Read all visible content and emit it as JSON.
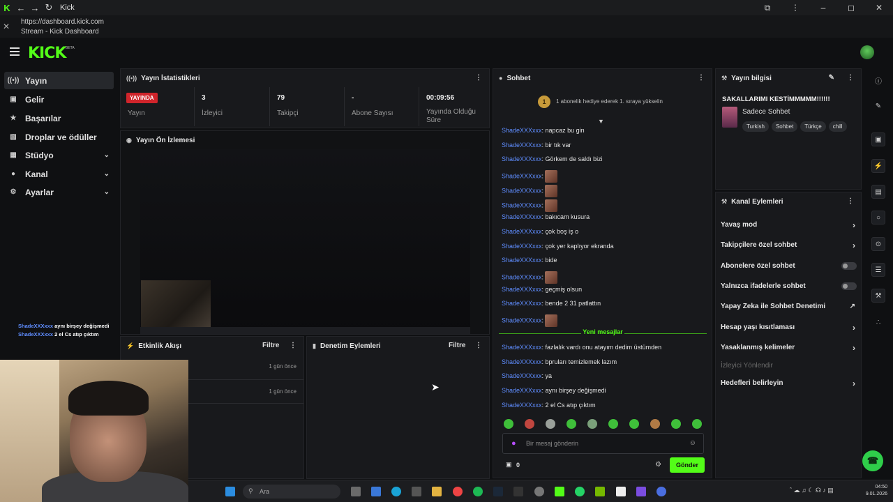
{
  "window": {
    "title": "Kick",
    "url": "https://dashboard.kick.com",
    "page_title": "Stream - Kick Dashboard"
  },
  "brand": {
    "logo": "KICK",
    "logo_badge": "BETA",
    "accent": "#53fc18"
  },
  "sidebar": {
    "items": [
      {
        "label": "Yayın",
        "icon": "broadcast-icon"
      },
      {
        "label": "Gelir",
        "icon": "wallet-icon"
      },
      {
        "label": "Başarılar",
        "icon": "trophy-icon"
      },
      {
        "label": "Droplar ve ödüller",
        "icon": "gift-icon"
      },
      {
        "label": "Stüdyo",
        "icon": "layout-icon",
        "expandable": true
      },
      {
        "label": "Kanal",
        "icon": "user-icon",
        "expandable": true
      },
      {
        "label": "Ayarlar",
        "icon": "gear-icon",
        "expandable": true
      }
    ]
  },
  "stats": {
    "title": "Yayın İstatistikleri",
    "live_badge": "YAYINDA",
    "items": [
      {
        "value": "",
        "label": "Yayın"
      },
      {
        "value": "3",
        "label": "İzleyici"
      },
      {
        "value": "79",
        "label": "Takipçi"
      },
      {
        "value": "-",
        "label": "Abone Sayısı"
      },
      {
        "value": "00:09:56",
        "label": "Yayında Olduğu Süre"
      }
    ]
  },
  "preview": {
    "title": "Yayın Ön İzlemesi"
  },
  "activity": {
    "title": "Etkinlik Akışı",
    "filter": "Filtre",
    "rows": [
      {
        "time": "1 gün önce"
      },
      {
        "time": "1 gün önce"
      }
    ]
  },
  "moderation": {
    "title": "Denetim Eylemleri",
    "filter": "Filtre"
  },
  "chat": {
    "title": "Sohbet",
    "gift_badge": "1",
    "gift_text": "1 abonelik hediye ederek 1. sıraya yükselin",
    "messages": [
      {
        "user": "ShadeXXXxxx",
        "text": ": napcaz bu gin"
      },
      {
        "user": "ShadeXXXxxx",
        "text": ": bir tık var"
      },
      {
        "user": "ShadeXXXxxx",
        "text": ": Görkem de saldı bizi"
      },
      {
        "user": "ShadeXXXxxx",
        "text": ":",
        "emote": true
      },
      {
        "user": "ShadeXXXxxx",
        "text": ":",
        "emote": true
      },
      {
        "user": "ShadeXXXxxx",
        "text": ":",
        "emote": true
      },
      {
        "user": "ShadeXXXxxx",
        "text": ": bakıcam kusura"
      },
      {
        "user": "ShadeXXXxxx",
        "text": ": çok boş iş o"
      },
      {
        "user": "ShadeXXXxxx",
        "text": ": çok yer kaplıyor ekranda"
      },
      {
        "user": "ShadeXXXxxx",
        "text": ": bide"
      },
      {
        "user": "ShadeXXXxxx",
        "text": ":",
        "emote": true
      },
      {
        "user": "ShadeXXXxxx",
        "text": ": geçmiş olsun"
      },
      {
        "user": "ShadeXXXxxx",
        "text": ": bende 2 31 patlattın"
      },
      {
        "user": "ShadeXXXxxx",
        "text": ":",
        "emote": true
      }
    ],
    "new_messages_label": "Yeni mesajlar",
    "new_messages": [
      {
        "user": "ShadeXXXxxx",
        "text": ": fazlalık vardı onu atayım dedim üstümden"
      },
      {
        "user": "ShadeXXXxxx",
        "text": ": bpruları temizlemek lazım"
      },
      {
        "user": "ShadeXXXxxx",
        "text": ": ya"
      },
      {
        "user": "ShadeXXXxxx",
        "text": ": aynı birşey değişmedi"
      },
      {
        "user": "ShadeXXXxxx",
        "text": ": 2 el Cs atıp çıktım"
      }
    ],
    "input_placeholder": "Bir mesaj gönderin",
    "points": "0",
    "send_label": "Gönder"
  },
  "stream_info": {
    "title": "Yayın bilgisi",
    "stream_title": "SAKALLARIMI KESTİMMMMM!!!!!!",
    "category": "Sadece Sohbet",
    "tags": [
      "Turkish",
      "Sohbet",
      "Türkçe",
      "chill"
    ]
  },
  "channel_actions": {
    "title": "Kanal Eylemleri",
    "items": [
      {
        "label": "Yavaş mod",
        "type": "arrow"
      },
      {
        "label": "Takipçilere özel sohbet",
        "type": "arrow"
      },
      {
        "label": "Abonelere özel sohbet",
        "type": "toggle"
      },
      {
        "label": "Yalnızca ifadelerle sohbet",
        "type": "toggle"
      },
      {
        "label": "Yapay Zeka ile Sohbet Denetimi",
        "type": "external"
      },
      {
        "label": "Hesap yaşı kısıtlaması",
        "type": "arrow"
      },
      {
        "label": "Yasaklanmış kelimeler",
        "type": "arrow"
      },
      {
        "label": "İzleyici Yönlendir",
        "type": "disabled"
      },
      {
        "label": "Hedefleri belirleyin",
        "type": "arrow"
      }
    ]
  },
  "overlay_chat": [
    {
      "user": "ShadeXXXxxx",
      "text": "aynı birşey değişmedi"
    },
    {
      "user": "ShadeXXXxxx",
      "text": "2 el Cs atıp çıktım"
    }
  ],
  "taskbar": {
    "search_placeholder": "Ara",
    "time": "04:50",
    "date": "9.01.2026"
  }
}
